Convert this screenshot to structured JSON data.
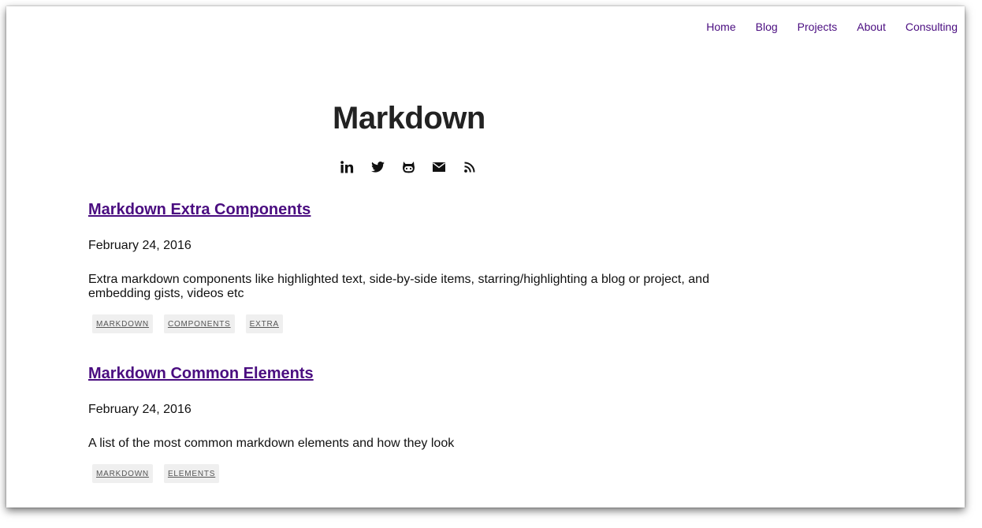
{
  "nav": {
    "items": [
      "Home",
      "Blog",
      "Projects",
      "About",
      "Consulting"
    ]
  },
  "header": {
    "title": "Markdown",
    "social_icons": [
      "linkedin-icon",
      "twitter-icon",
      "github-icon",
      "mail-icon",
      "rss-icon"
    ]
  },
  "posts": [
    {
      "title": "Markdown Extra Components",
      "date": "February 24, 2016",
      "summary": "Extra markdown components like highlighted text, side-by-side items, starring/highlighting a blog or project, and embedding gists, videos etc",
      "tags": [
        "MARKDOWN",
        "COMPONENTS",
        "EXTRA"
      ]
    },
    {
      "title": "Markdown Common Elements",
      "date": "February 24, 2016",
      "summary": "A list of the most common markdown elements and how they look",
      "tags": [
        "MARKDOWN",
        "ELEMENTS"
      ]
    }
  ],
  "colors": {
    "link": "#4a0d80",
    "title": "#222222",
    "tag_bg": "#efefef"
  }
}
